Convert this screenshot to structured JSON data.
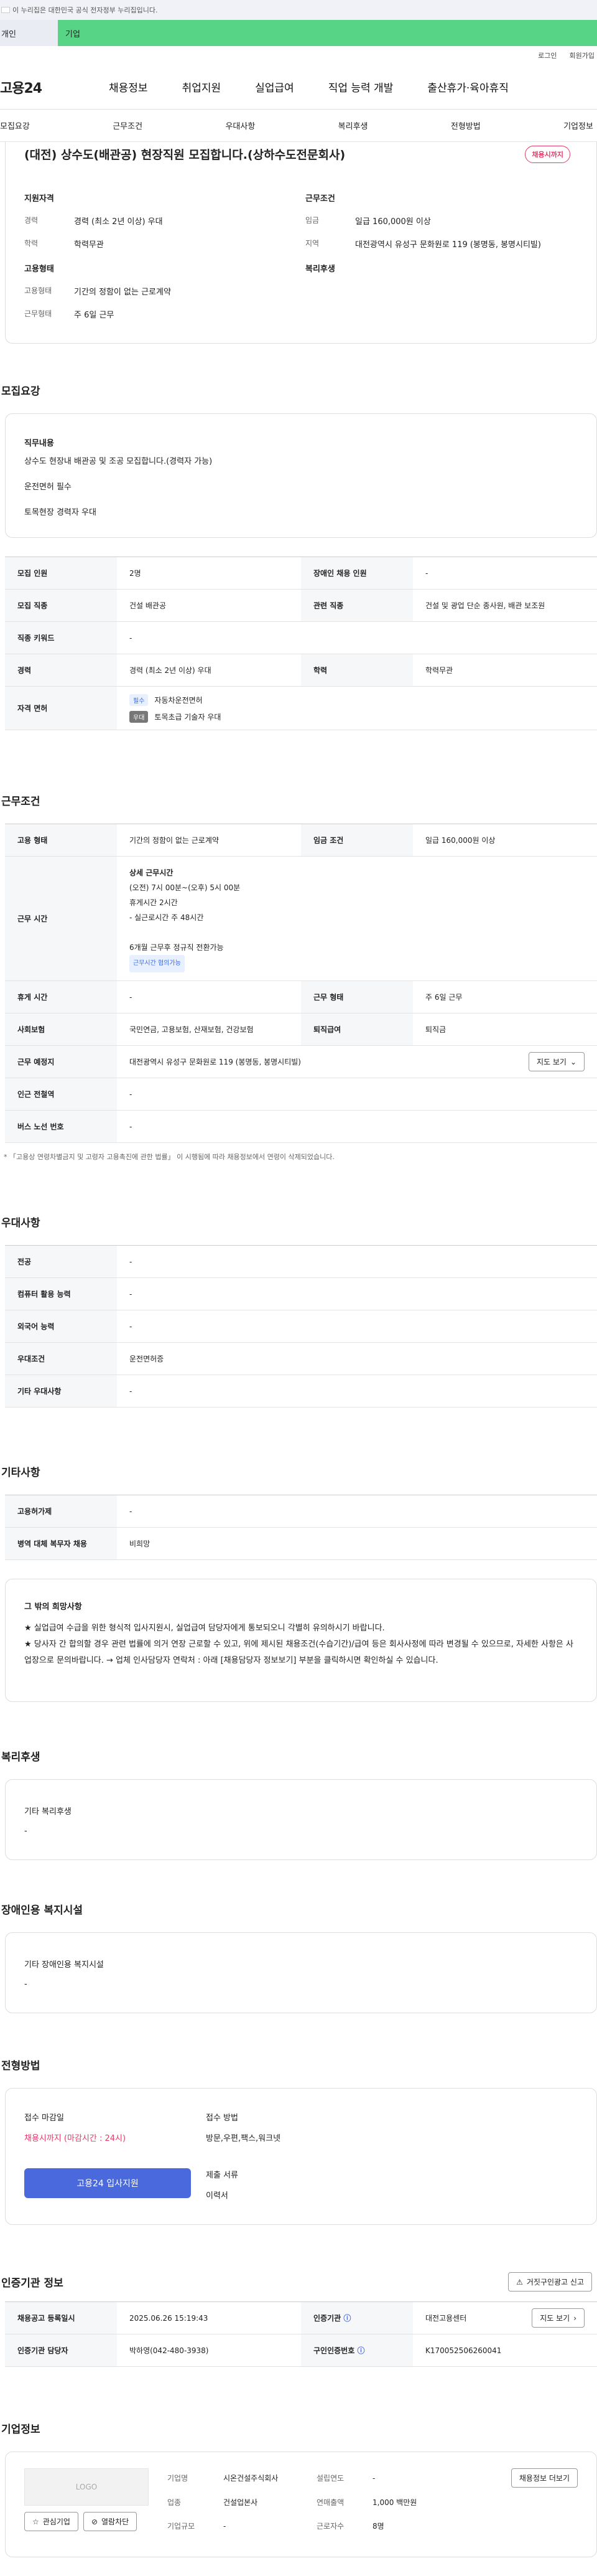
{
  "gov_banner": "이 누리집은 대한민국 공식 전자정부 누리집입니다.",
  "top_tabs": [
    "개인",
    "기업"
  ],
  "util": [
    "로그인",
    "회원가입"
  ],
  "logo": "고용24",
  "gnb": [
    "채용정보",
    "취업지원",
    "실업급여",
    "직업 능력 개발",
    "출산휴가·육아휴직"
  ],
  "snb": [
    "모집요강",
    "근무조건",
    "우대사항",
    "복리후생",
    "전형방법",
    "기업정보"
  ],
  "job_title": "(대전) 상수도(배관공) 현장직원 모집합니다.(상하수도전문회사)",
  "job_badge": "채용시까지",
  "summary": {
    "qual_h": "지원자격",
    "career_k": "경력",
    "career_v": "경력 (최소 2년 이상) 우대",
    "edu_k": "학력",
    "edu_v": "학력무관",
    "emp_h": "고용형태",
    "emp_k": "고용형태",
    "emp_v": "기간의 정함이 없는 근로계약",
    "days_k": "근무형태",
    "days_v": "주 6일 근무",
    "cond_h": "근무조건",
    "wage_k": "임금",
    "wage_v": "일급 160,000원 이상",
    "loc_k": "지역",
    "loc_v": "대전광역시 유성구 문화원로 119 (봉명동, 봉명시티빌)",
    "welfare_h": "복리후생"
  },
  "recruit": {
    "title": "모집요강",
    "duty_h": "직무내용",
    "duty_lines": [
      "상수도 현장내 배관공 및 조공 모집합니다.(경력자 가능)",
      "운전면허 필수",
      "토목현장 경력자 우대"
    ],
    "rows": [
      [
        "모집 인원",
        "2명",
        "장애인 채용 인원",
        "-"
      ],
      [
        "모집 직종",
        "건설 배관공",
        "관련 직종",
        "건설 및 광업 단순 종사원, 배관 보조원"
      ],
      [
        "직종 키워드",
        "-",
        "",
        ""
      ],
      [
        "경력",
        "경력 (최소 2년 이상) 우대",
        "학력",
        "학력무관"
      ]
    ],
    "license_k": "자격 면허",
    "license_chip1": "필수",
    "license_v1": "자동차운전면허",
    "license_chip2": "우대",
    "license_v2": "토목초급 기술자 우대"
  },
  "work": {
    "title": "근무조건",
    "emp_k": "고용 형태",
    "emp_v": "기간의 정함이 없는 근로계약",
    "wage_k": "임금 조건",
    "wage_v": "일급 160,000원 이상",
    "time_k": "근무 시간",
    "time_h": "상세 근무시간",
    "time_lines": [
      "(오전) 7시 00분~(오후) 5시 00분",
      "휴게시간 2시간",
      "- 실근로시간 주 48시간",
      "",
      "6개월 근무후 정규직 전환가능"
    ],
    "time_chip": "근무시간 협의가능",
    "rows": [
      [
        "휴게 시간",
        "-",
        "근무 형태",
        "주 6일 근무"
      ],
      [
        "사회보험",
        "국민연금, 고용보험, 산재보험, 건강보험",
        "퇴직급여",
        "퇴직금"
      ]
    ],
    "place_k": "근무 예정지",
    "place_v": "대전광역시 유성구 문화원로 119 (봉명동, 봉명시티빌)",
    "map_btn": "지도 보기",
    "station_k": "인근 전철역",
    "station_v": "-",
    "bus_k": "버스 노선 번호",
    "bus_v": "-",
    "note": "* 「고용상 연령차별금지 및 고령자 고용촉진에 관한 법률」 이 시행됨에 따라 채용정보에서 연령이 삭제되었습니다."
  },
  "pref": {
    "title": "우대사항",
    "rows": [
      [
        "전공",
        "-"
      ],
      [
        "컴퓨터 활용 능력",
        "-"
      ],
      [
        "외국어 능력",
        "-"
      ],
      [
        "우대조건",
        "운전면허증"
      ],
      [
        "기타 우대사항",
        "-"
      ]
    ]
  },
  "etc": {
    "title": "기타사항",
    "rows": [
      [
        "고용허가제",
        "-"
      ],
      [
        "병역 대체 복무자 채용",
        "비희망"
      ]
    ],
    "other_h": "그 밖의 희망사항",
    "other_lines": [
      "★ 실업급여 수급을 위한 형식적 입사지원시, 실업급여 담당자에게 통보되오니 각별히 유의하시기 바랍니다.",
      "★ 당사자 간 합의할 경우 관련 법률에 의거 연장 근로할 수 있고, 위에 제시된 채용조건(수습기간)/급여 등은 회사사정에 따라 변경될 수 있으므로, 자세한 사항은 사업장으로 문의바랍니다. → 업체 인사담당자 연락처 : 아래 [채용담당자 정보보기] 부분을 클릭하시면 확인하실 수 있습니다."
    ]
  },
  "welfare": {
    "title": "복리후생",
    "h": "기타 복리후생",
    "v": "-"
  },
  "disabled": {
    "title": "장애인용 복지시설",
    "h": "기타 장애인용 복지시설",
    "v": "-"
  },
  "process": {
    "title": "전형방법",
    "deadline_h": "접수 마감일",
    "deadline_v": "채용시까지 (마감시간 : 24시)",
    "method_h": "접수 방법",
    "method_v": "방문,우편,팩스,워크넷",
    "docs_h": "제출 서류",
    "docs_v": "이력서",
    "apply": "고용24 입사지원"
  },
  "cert": {
    "title": "인증기관 정보",
    "report_btn": "거짓구인광고 신고",
    "reg_k": "채용공고 등록일시",
    "reg_v": "2025.06.26 15:19:43",
    "org_k": "인증기관",
    "org_v": "대전고용센터",
    "view_btn": "지도 보기",
    "mgr_k": "인증기관 담당자",
    "mgr_v": "박하영(042-480-3938)",
    "no_k": "구인인증번호",
    "no_v": "K170052506260041"
  },
  "company": {
    "title": "기업정보",
    "logo": "LOGO",
    "fav": "관심기업",
    "block": "열람차단",
    "name_k": "기업명",
    "name_v": "시온건설주식회사",
    "est_k": "설립연도",
    "est_v": "-",
    "ind_k": "업종",
    "ind_v": "건설업본사",
    "sales_k": "연매출액",
    "sales_v": "1,000 백만원",
    "size_k": "기업규모",
    "size_v": "-",
    "emp_k": "근로자수",
    "emp_v": "8명",
    "jobs_btn": "채용정보 더보기"
  }
}
